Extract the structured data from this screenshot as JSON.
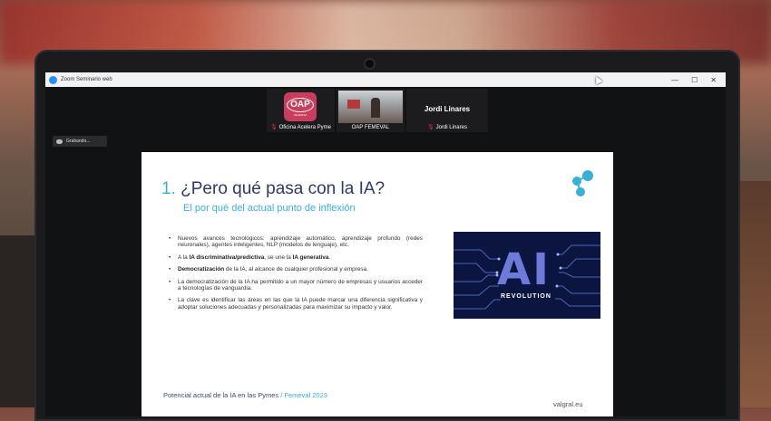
{
  "window": {
    "title": "Zoom Seminario web",
    "controls": [
      "—",
      "☐",
      "✕"
    ]
  },
  "participants": [
    {
      "name": "Oficina Acelera Pyme",
      "logo_text": "OAP",
      "logo_sub": "VALENCIA"
    },
    {
      "name": "OAP FEMEVAL"
    },
    {
      "name": "Jordi Linares",
      "display_name": "Jordi Linares"
    }
  ],
  "recording": {
    "label": "Grabando..."
  },
  "slide": {
    "title_number": "1.",
    "title": "¿Pero qué pasa con la IA?",
    "subtitle": "El por qué del actual punto de inflexión",
    "bullets": [
      {
        "parts": [
          {
            "t": "Nuevos avances tecnológicos: aprendizaje automático, aprendizaje profundo (redes neuronales), agentes inteligentes, NLP (modelos de lenguaje), etc.",
            "b": false
          }
        ]
      },
      {
        "parts": [
          {
            "t": "A la ",
            "b": false
          },
          {
            "t": "IA discriminativa/predictiva",
            "b": true
          },
          {
            "t": ", se une la ",
            "b": false
          },
          {
            "t": "IA generativa",
            "b": true
          },
          {
            "t": ".",
            "b": false
          }
        ]
      },
      {
        "parts": [
          {
            "t": "Democratización",
            "b": true
          },
          {
            "t": " de la IA, al alcance de cualquier profesional y empresa.",
            "b": false
          }
        ]
      },
      {
        "parts": [
          {
            "t": "La democratización de la IA ha permitido a un mayor número de empresas y usuarios acceder a tecnologías de vanguardia.",
            "b": false
          }
        ]
      },
      {
        "parts": [
          {
            "t": "La clave es identificar las áreas en las que la IA puede marcar una diferencia significativa y adoptar soluciones adecuadas y personalizadas para maximizar su impacto y valor.",
            "b": false
          }
        ]
      }
    ],
    "image": {
      "big_text": "AI",
      "caption": "REVOLUTION"
    },
    "footer_left": "Potencial actual de la IA en las Pymes",
    "footer_left_accent": " / Femeval 2023",
    "footer_right": "valgral.eu"
  },
  "colors": {
    "title": "#2f3a64",
    "accent": "#3bb0d6",
    "recording": "#2a2b2e"
  }
}
